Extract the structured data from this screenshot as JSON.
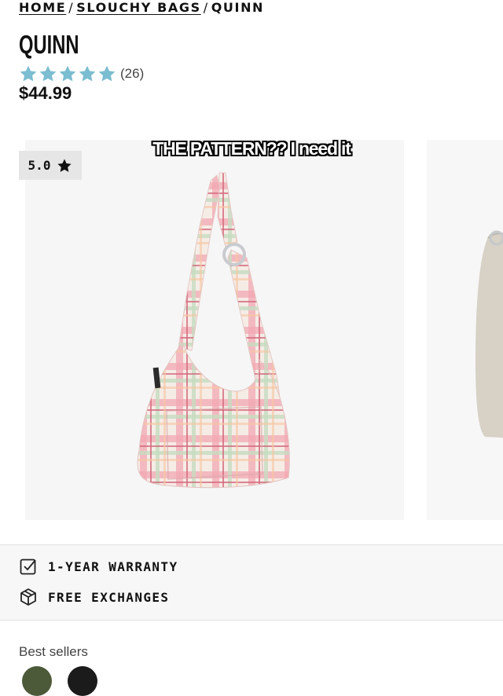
{
  "breadcrumb": {
    "home": "HOME",
    "category": "SLOUCHY BAGS",
    "current": "QUINN",
    "separator": "/"
  },
  "product": {
    "name": "QUINN",
    "rating_stars": 5,
    "review_count": "(26)",
    "price": "$44.99"
  },
  "gallery": {
    "score_badge": "5.0",
    "caption": "THE PATTERN?? I need it"
  },
  "features": [
    {
      "label": "1-YEAR WARRANTY",
      "icon": "checkbox-icon"
    },
    {
      "label": "FREE EXCHANGES",
      "icon": "box-icon"
    }
  ],
  "best_sellers": {
    "label": "Best sellers"
  },
  "colors": {
    "star": "#7bbdd1",
    "swatch_green": "#4d5a3a",
    "swatch_black": "#1b1b1b"
  }
}
